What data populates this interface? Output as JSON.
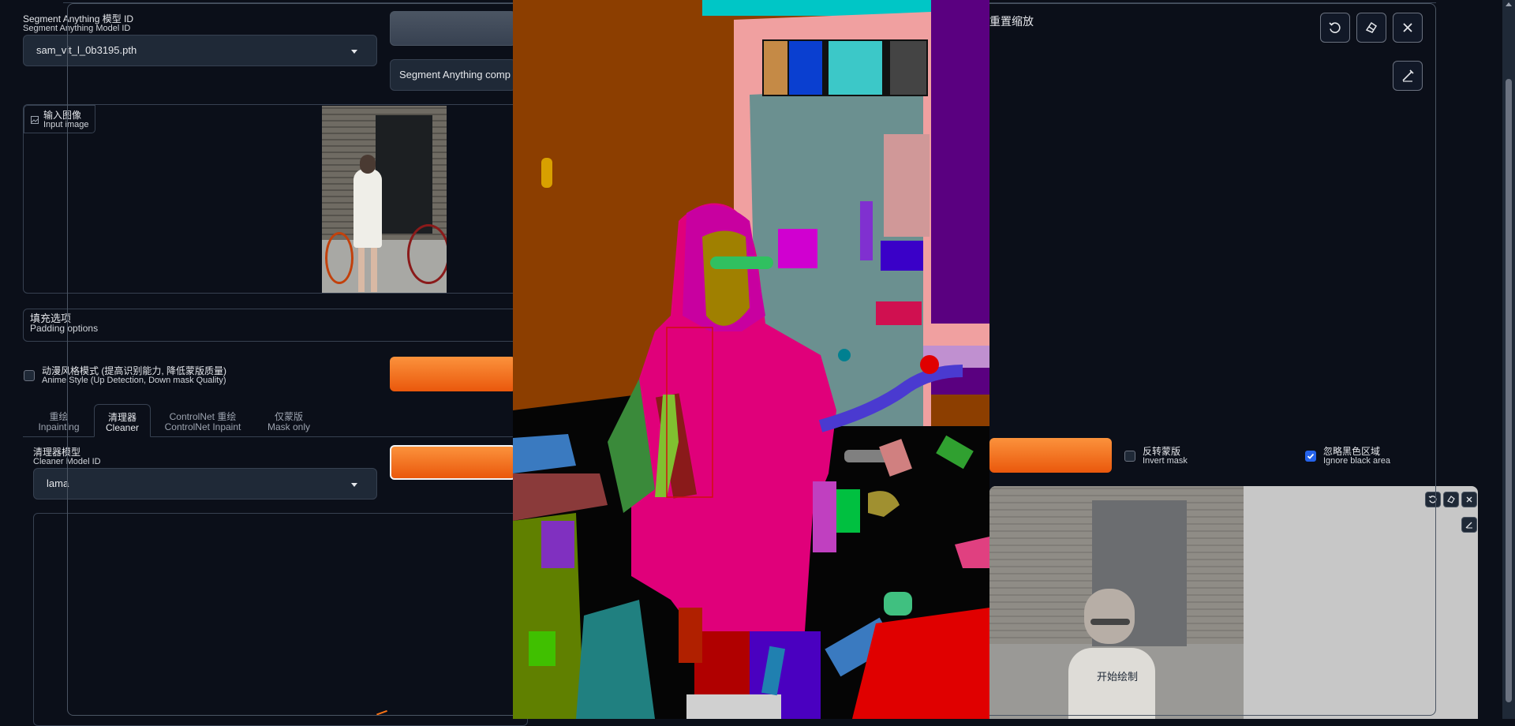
{
  "model": {
    "label_cn": "Segment Anything 模型 ID",
    "label_en": "Segment Anything Model ID",
    "value": "sam_vit_l_0b3195.pth"
  },
  "sam_comp": {
    "text": "Segment Anything comp"
  },
  "input_image": {
    "label_cn": "输入图像",
    "label_en": "Input image"
  },
  "padding": {
    "label_cn": "填充选项",
    "label_en": "Padding options"
  },
  "anime": {
    "label_cn": "动漫风格模式 (提高识别能力, 降低蒙版质量)",
    "label_en": "Anime Style (Up Detection, Down mask Quality)",
    "checked": false
  },
  "tabs": [
    {
      "cn": "重绘",
      "en": "Inpainting"
    },
    {
      "cn": "清理器",
      "en": "Cleaner"
    },
    {
      "cn": "ControlNet 重绘",
      "en": "ControlNet Inpaint"
    },
    {
      "cn": "仅蒙版",
      "en": "Mask only"
    }
  ],
  "cleaner": {
    "label_cn": "清理器模型",
    "label_en": "Cleaner Model ID",
    "value": "lama"
  },
  "reset_zoom": {
    "text": "重置缩放"
  },
  "invert_mask": {
    "label_cn": "反转蒙版",
    "label_en": "Invert mask",
    "checked": false
  },
  "ignore_black": {
    "label_cn": "忽略黑色区域",
    "label_en": "Ignore black area",
    "checked": true
  },
  "start_draw": {
    "text": "开始绘制"
  },
  "colors": {
    "bg": "#0b0f19",
    "orange": "#f97316",
    "checkbox_blue": "#2563eb"
  }
}
